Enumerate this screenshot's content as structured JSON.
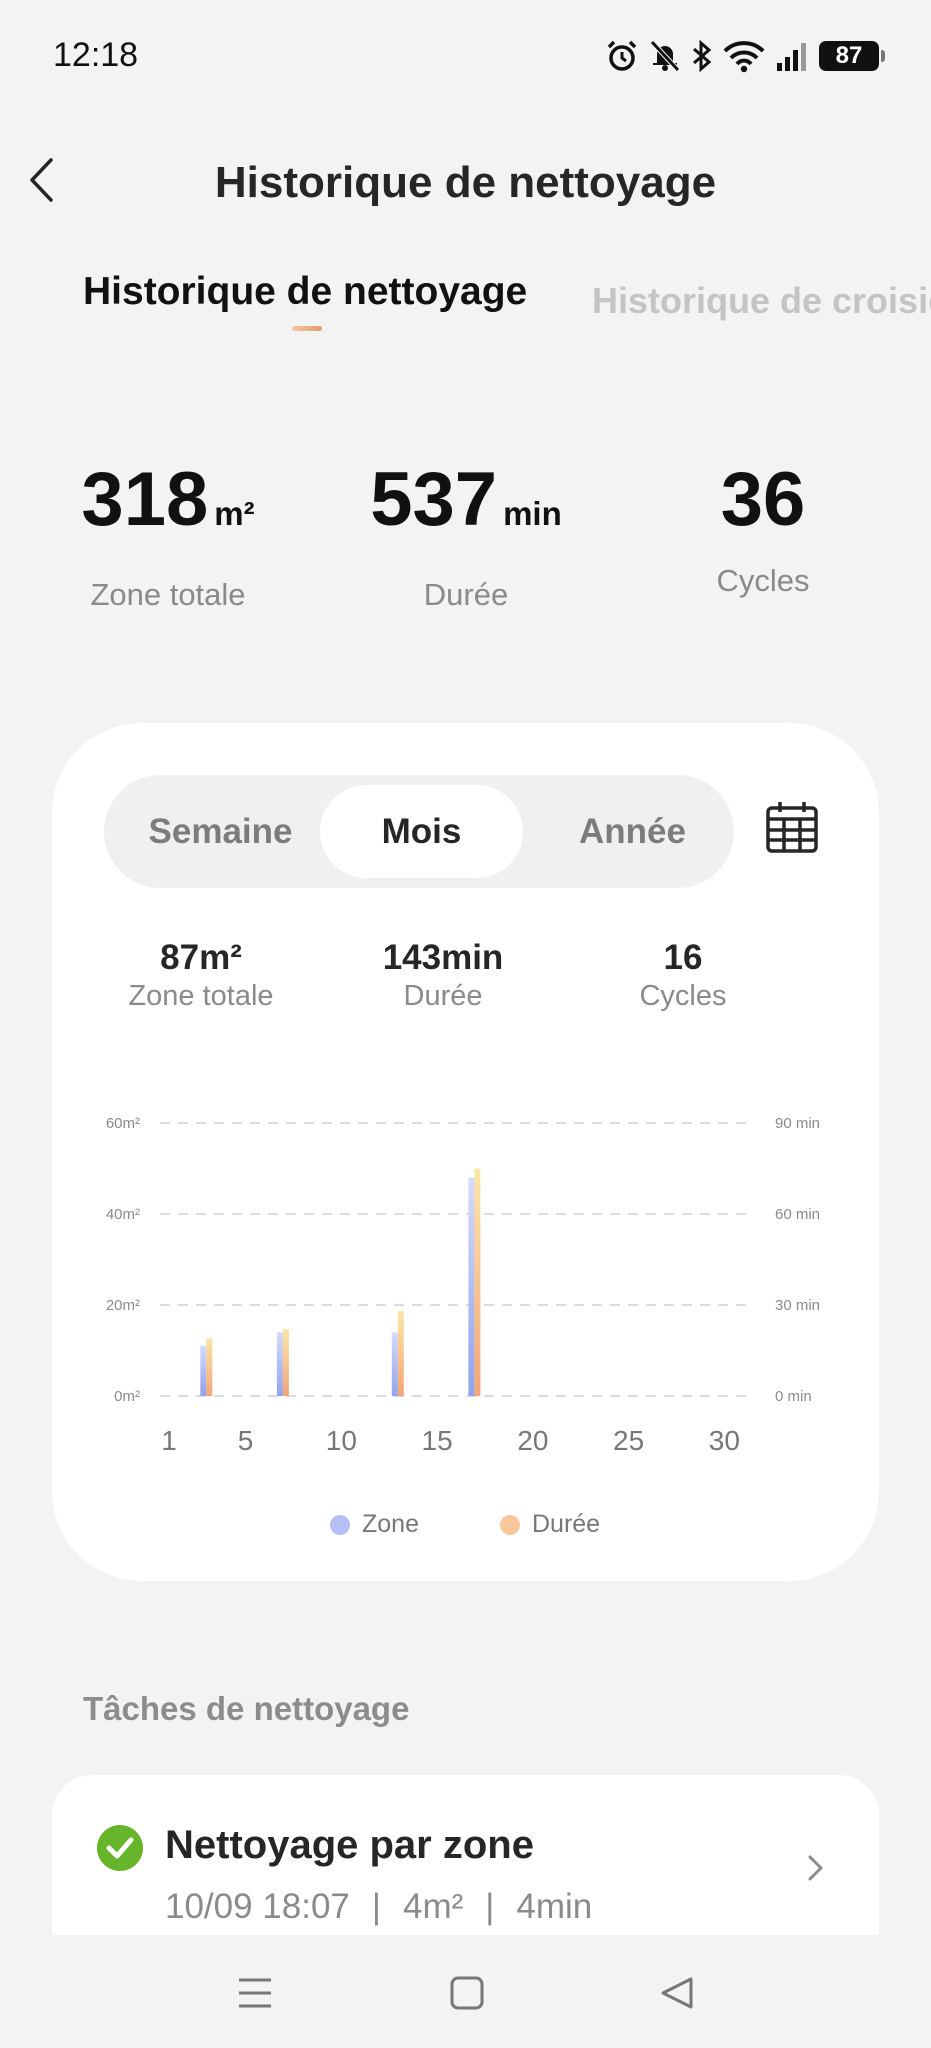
{
  "status_bar": {
    "time": "12:18",
    "battery": "87",
    "icons": [
      "alarm-icon",
      "bell-off-icon",
      "bluetooth-icon",
      "wifi-icon",
      "signal-icon",
      "battery-icon"
    ]
  },
  "header": {
    "title": "Historique de nettoyage",
    "back_icon": "chevron-left-icon"
  },
  "tabs": [
    {
      "label": "Historique de nettoyage",
      "active": true
    },
    {
      "label": "Historique de croisiè",
      "active": false
    }
  ],
  "summary": {
    "area": {
      "value": "318",
      "unit": "m²",
      "label": "Zone totale"
    },
    "duration": {
      "value": "537",
      "unit": "min",
      "label": "Durée"
    },
    "cycles": {
      "value": "36",
      "label": "Cycles"
    }
  },
  "period_selector": {
    "options": [
      "Semaine",
      "Mois",
      "Année"
    ],
    "selected": "Mois",
    "calendar_icon": "calendar-icon"
  },
  "period_stats": {
    "area": {
      "value": "87m²",
      "label": "Zone totale"
    },
    "duration": {
      "value": "143min",
      "label": "Durée"
    },
    "cycles": {
      "value": "16",
      "label": "Cycles"
    }
  },
  "chart_data": {
    "type": "bar",
    "x_ticks": [
      "1",
      "5",
      "10",
      "15",
      "20",
      "25",
      "30"
    ],
    "xlim": [
      1,
      31
    ],
    "y_left": {
      "ticks": [
        "0m²",
        "20m²",
        "40m²",
        "60m²"
      ],
      "ylim": [
        0,
        60
      ],
      "unit": "m²"
    },
    "y_right": {
      "ticks": [
        "0 min",
        "30 min",
        "60 min",
        "90 min"
      ],
      "ylim": [
        0,
        90
      ],
      "unit": "min"
    },
    "grid": true,
    "legend_position": "bottom",
    "series": [
      {
        "name": "Zone",
        "axis": "left",
        "color": "#9fb0f0",
        "days": [
          3,
          7,
          13,
          17
        ],
        "values": [
          11,
          14,
          14,
          48
        ]
      },
      {
        "name": "Durée",
        "axis": "right",
        "color": "#f6b68a",
        "days": [
          3,
          7,
          13,
          17
        ],
        "values": [
          19,
          22,
          28,
          75
        ]
      }
    ]
  },
  "legend": {
    "zone": {
      "label": "Zone",
      "color": "#aeb9f5"
    },
    "duration": {
      "label": "Durée",
      "color": "#f9c79c"
    }
  },
  "tasks_section": {
    "title": "Tâches de nettoyage",
    "items": [
      {
        "title": "Nettoyage par zone",
        "datetime": "10/09 18:07",
        "area": "4m²",
        "duration": "4min",
        "separator": "|"
      }
    ]
  },
  "nav_bar": {
    "icons": [
      "menu-icon",
      "home-icon",
      "back-icon"
    ]
  }
}
